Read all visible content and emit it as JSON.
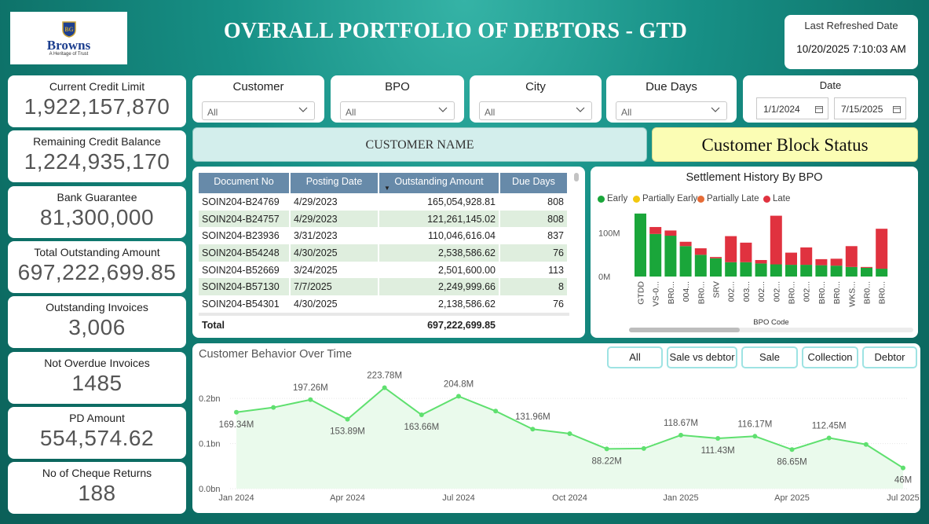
{
  "logo": {
    "brand": "Browns",
    "tagline": "A Heritage of Trust"
  },
  "header": {
    "title": "OVERALL PORTFOLIO OF DEBTORS - GTD"
  },
  "refresh": {
    "label": "Last Refreshed Date",
    "value": "10/20/2025 7:10:03 AM"
  },
  "kpis": [
    {
      "label": "Current Credit Limit",
      "value": "1,922,157,870"
    },
    {
      "label": "Remaining Credit Balance",
      "value": "1,224,935,170"
    },
    {
      "label": "Bank Guarantee",
      "value": "81,300,000"
    },
    {
      "label": "Total Outstanding Amount",
      "value": "697,222,699.85"
    },
    {
      "label": "Outstanding Invoices",
      "value": "3,006"
    },
    {
      "label": "Not Overdue Invoices",
      "value": "1485"
    },
    {
      "label": "PD Amount",
      "value": "554,574.62"
    },
    {
      "label": "No of Cheque Returns",
      "value": "188"
    }
  ],
  "slicers": [
    {
      "title": "Customer",
      "value": "All"
    },
    {
      "title": "BPO",
      "value": "All"
    },
    {
      "title": "City",
      "value": "All"
    },
    {
      "title": "Due Days",
      "value": "All"
    }
  ],
  "date_slicer": {
    "title": "Date",
    "from": "1/1/2024",
    "to": "7/15/2025"
  },
  "customer_name": "CUSTOMER NAME",
  "block_status": "Customer Block Status",
  "table": {
    "headers": [
      "Document No",
      "Posting Date",
      "Outstanding Amount",
      "Due Days"
    ],
    "rows": [
      [
        "SOIN204-B24769",
        "4/29/2023",
        "165,054,928.81",
        "808"
      ],
      [
        "SOIN204-B24757",
        "4/29/2023",
        "121,261,145.02",
        "808"
      ],
      [
        "SOIN204-B23936",
        "3/31/2023",
        "110,046,616.04",
        "837"
      ],
      [
        "SOIN204-B54248",
        "4/30/2025",
        "2,538,586.62",
        "76"
      ],
      [
        "SOIN204-B52669",
        "3/24/2025",
        "2,501,600.00",
        "113"
      ],
      [
        "SOIN204-B57130",
        "7/7/2025",
        "2,249,999.66",
        "8"
      ],
      [
        "SOIN204-B54301",
        "4/30/2025",
        "2,138,586.62",
        "76"
      ]
    ],
    "total_label": "Total",
    "total_value": "697,222,699.85"
  },
  "chart_data": [
    {
      "type": "bar",
      "stacked": true,
      "title": "Settlement History By BPO",
      "xlabel": "BPO Code",
      "ylabel": "",
      "yticks": [
        "0M",
        "100M"
      ],
      "ylim": [
        0,
        170
      ],
      "legend": [
        "Early",
        "Partially Early",
        "Partially Late",
        "Late"
      ],
      "colors": {
        "Early": "#1aa63a",
        "Partially Early": "#f2c80f",
        "Partially Late": "#e66c37",
        "Late": "#e0323f"
      },
      "categories": [
        "GTDD",
        "VS-0...",
        "BR0...",
        "004...",
        "BR0...",
        "SRV",
        "002...",
        "003...",
        "002...",
        "002...",
        "BR0...",
        "002...",
        "BR0...",
        "BR0...",
        "WKS...",
        "BR0...",
        "BR0..."
      ],
      "series": [
        {
          "name": "Early",
          "values": [
            145,
            98,
            94,
            70,
            50,
            42,
            33,
            33,
            30,
            28,
            27,
            27,
            26,
            25,
            22,
            20,
            18
          ]
        },
        {
          "name": "Partially Early",
          "values": [
            0,
            0,
            0,
            0,
            0,
            0,
            0,
            0,
            0,
            0,
            0,
            0,
            0,
            0,
            0,
            0,
            0
          ]
        },
        {
          "name": "Partially Late",
          "values": [
            0,
            0,
            0,
            0,
            0,
            0,
            0,
            0,
            0,
            0,
            0,
            0,
            0,
            0,
            0,
            0,
            0
          ]
        },
        {
          "name": "Late",
          "values": [
            0,
            16,
            12,
            10,
            15,
            3,
            60,
            45,
            8,
            112,
            28,
            40,
            14,
            16,
            48,
            2,
            92
          ]
        }
      ]
    },
    {
      "type": "area",
      "title": "Customer Behavior Over Time",
      "xlabel": "",
      "ylabel": "",
      "xticks": [
        "Jan 2024",
        "Apr 2024",
        "Jul 2024",
        "Oct 2024",
        "Jan 2025",
        "Apr 2025",
        "Jul 2025"
      ],
      "yticks": [
        "0.0bn",
        "0.1bn",
        "0.2bn"
      ],
      "ylim": [
        0,
        0.27
      ],
      "x": [
        "2024-01",
        "2024-02",
        "2024-03",
        "2024-04",
        "2024-05",
        "2024-06",
        "2024-07",
        "2024-08",
        "2024-09",
        "2024-10",
        "2024-11",
        "2024-12",
        "2025-01",
        "2025-02",
        "2025-03",
        "2025-04",
        "2025-05",
        "2025-06",
        "2025-07"
      ],
      "series": [
        {
          "values": [
            169.34,
            180,
            197.26,
            153.89,
            223.78,
            163.66,
            204.8,
            172,
            131.96,
            122,
            88.22,
            89,
            118.67,
            111.43,
            116.17,
            86.65,
            112.45,
            98,
            46
          ]
        }
      ],
      "labels": [
        "169.34M",
        "",
        "197.26M",
        "153.89M",
        "223.78M",
        "163.66M",
        "204.8M",
        "",
        "131.96M",
        "",
        "88.22M",
        "",
        "118.67M",
        "111.43M",
        "116.17M",
        "86.65M",
        "112.45M",
        "",
        "46M"
      ],
      "color": "#5fe06f"
    }
  ],
  "behavior_buttons": [
    "All",
    "Sale vs debtor",
    "Sale",
    "Collection",
    "Debtor"
  ]
}
